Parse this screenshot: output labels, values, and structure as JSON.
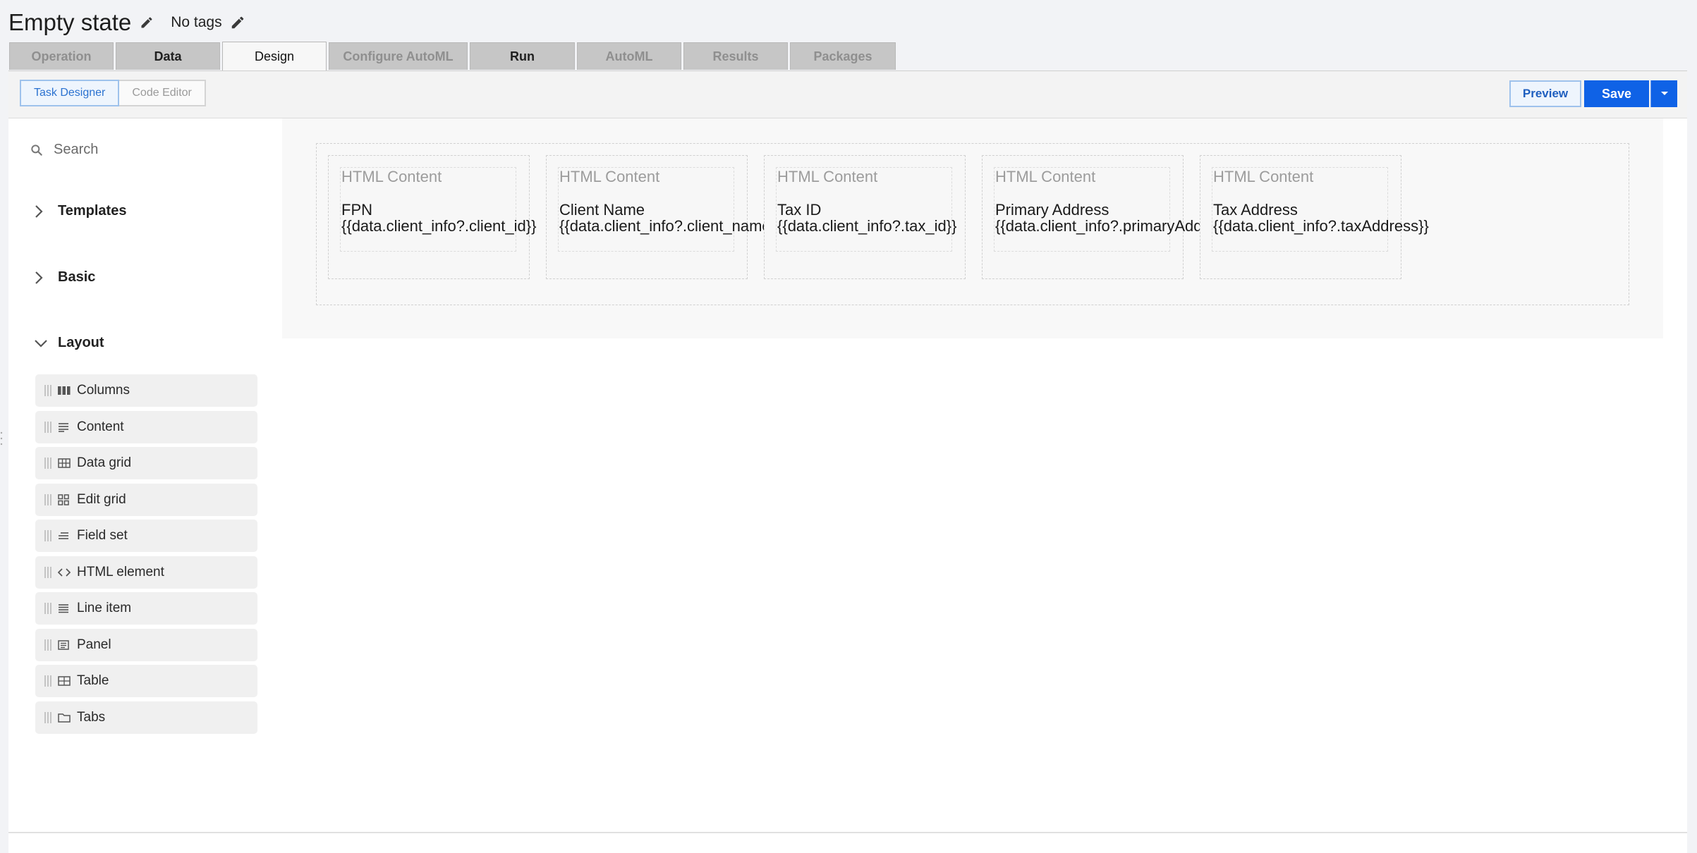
{
  "header": {
    "title": "Empty state",
    "tags": "No tags"
  },
  "tabs": [
    {
      "label": "Operation",
      "state": "disabled"
    },
    {
      "label": "Data",
      "state": "enabled"
    },
    {
      "label": "Design",
      "state": "active"
    },
    {
      "label": "Configure AutoML",
      "state": "disabled"
    },
    {
      "label": "Run",
      "state": "enabled"
    },
    {
      "label": "AutoML",
      "state": "disabled"
    },
    {
      "label": "Results",
      "state": "disabled"
    },
    {
      "label": "Packages",
      "state": "disabled"
    }
  ],
  "toolbar": {
    "modes": [
      {
        "label": "Task Designer"
      },
      {
        "label": "Code Editor"
      }
    ],
    "preview": "Preview",
    "save": "Save"
  },
  "sidebar": {
    "search_placeholder": "Search",
    "sections": [
      {
        "label": "Templates",
        "expanded": false
      },
      {
        "label": "Basic",
        "expanded": false
      },
      {
        "label": "Layout",
        "expanded": true
      }
    ],
    "components": [
      {
        "label": "Columns",
        "icon": "columns-icon"
      },
      {
        "label": "Content",
        "icon": "content-icon"
      },
      {
        "label": "Data grid",
        "icon": "data-grid-icon"
      },
      {
        "label": "Edit grid",
        "icon": "edit-grid-icon"
      },
      {
        "label": "Field set",
        "icon": "field-set-icon"
      },
      {
        "label": "HTML element",
        "icon": "code-icon"
      },
      {
        "label": "Line item",
        "icon": "line-item-icon"
      },
      {
        "label": "Panel",
        "icon": "panel-icon"
      },
      {
        "label": "Table",
        "icon": "table-icon"
      },
      {
        "label": "Tabs",
        "icon": "folder-icon"
      }
    ]
  },
  "canvas": {
    "cards": [
      {
        "title": "HTML Content",
        "label": "FPN",
        "value": "{{data.client_info?.client_id}}"
      },
      {
        "title": "HTML Content",
        "label": "Client Name",
        "value": "{{data.client_info?.client_name}}"
      },
      {
        "title": "HTML Content",
        "label": "Tax ID",
        "value": "{{data.client_info?.tax_id}}"
      },
      {
        "title": "HTML Content",
        "label": "Primary Address",
        "value": "{{data.client_info?.primaryAddress}}"
      },
      {
        "title": "HTML Content",
        "label": "Tax Address",
        "value": "{{data.client_info?.taxAddress}}"
      }
    ]
  },
  "colors": {
    "primary": "#0f62e6",
    "active_mode": "#2b72d0"
  }
}
